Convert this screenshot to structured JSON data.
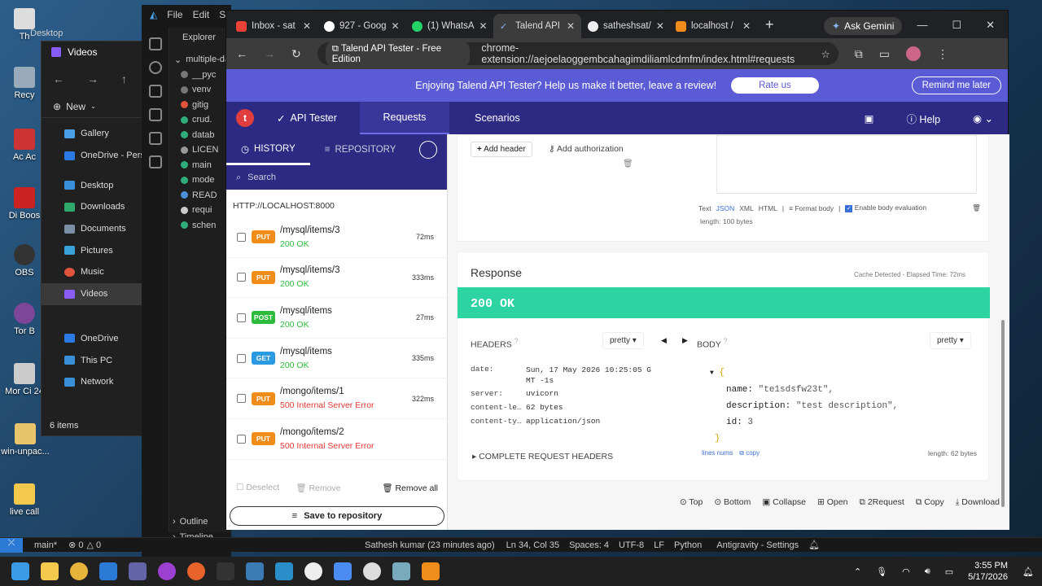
{
  "desktop": {
    "icons": [
      {
        "label": "Th"
      },
      {
        "label": "Recy"
      },
      {
        "label": "Ac Ac"
      },
      {
        "label": "Di Boos"
      },
      {
        "label": "OBS"
      },
      {
        "label": "Tor B"
      },
      {
        "label": "Mor Ci 24"
      },
      {
        "label": "win-unpac..."
      },
      {
        "label": "live call"
      }
    ]
  },
  "explorer": {
    "title": "Videos",
    "behind_title": "Desktop",
    "new_label": "New",
    "items": [
      {
        "label": "Gallery"
      },
      {
        "label": "OneDrive - Person"
      },
      {
        "label": "Desktop"
      },
      {
        "label": "Downloads"
      },
      {
        "label": "Documents"
      },
      {
        "label": "Pictures"
      },
      {
        "label": "Music"
      },
      {
        "label": "Videos"
      },
      {
        "label": "OneDrive"
      },
      {
        "label": "This PC"
      },
      {
        "label": "Network"
      }
    ],
    "status": "6 items"
  },
  "vscode": {
    "menu": [
      "File",
      "Edit",
      "S"
    ],
    "explorer_label": "Explorer",
    "folder": "multiple-da",
    "files": [
      "__pyc",
      "venv",
      "gitig",
      "crud.",
      "datab",
      "LICEN",
      "main",
      "mode",
      "READ",
      "requi",
      "schen"
    ],
    "outline": "Outline",
    "timeline": "Timeline",
    "status": {
      "branch": "main*",
      "problems": "0",
      "warnings": "0",
      "author": "Sathesh kumar (23 minutes ago)",
      "pos": "Ln 34, Col 35",
      "spaces": "Spaces: 4",
      "enc": "UTF-8",
      "eol": "LF",
      "lang": "Python",
      "settings": "Antigravity - Settings"
    }
  },
  "chrome": {
    "tabs": [
      {
        "title": "Inbox - sat"
      },
      {
        "title": "927 - Goog"
      },
      {
        "title": "(1) WhatsA"
      },
      {
        "title": "Talend API"
      },
      {
        "title": "satheshsat/"
      },
      {
        "title": "localhost /"
      }
    ],
    "gemini": "Ask Gemini",
    "site_chip": "Talend API Tester - Free Edition",
    "url": "chrome-extension://aejoelaoggembcahagimdiliamlcdmfm/index.html#requests"
  },
  "banner": {
    "text": "Enjoying Talend API Tester? Help us make it better, leave a review!",
    "rate": "Rate us",
    "remind": "Remind me later"
  },
  "appnav": {
    "logo": "t",
    "product": "API Tester",
    "tabs": [
      "Requests",
      "Scenarios"
    ],
    "help": "Help"
  },
  "history": {
    "tabs": [
      "HISTORY",
      "REPOSITORY"
    ],
    "search_placeholder": "Search",
    "host": "HTTP://LOCALHOST:8000",
    "rows": [
      {
        "method": "PUT",
        "color": "#f08c1a",
        "path": "/mysql/items/3",
        "status": "200 OK",
        "ok": true,
        "ms": "72ms"
      },
      {
        "method": "PUT",
        "color": "#f08c1a",
        "path": "/mysql/items/3",
        "status": "200 OK",
        "ok": true,
        "ms": "333ms"
      },
      {
        "method": "POST",
        "color": "#2dbb3c",
        "path": "/mysql/items",
        "status": "200 OK",
        "ok": true,
        "ms": "27ms"
      },
      {
        "method": "GET",
        "color": "#2b9ae0",
        "path": "/mysql/items",
        "status": "200 OK",
        "ok": true,
        "ms": "335ms"
      },
      {
        "method": "PUT",
        "color": "#f08c1a",
        "path": "/mongo/items/1",
        "status": "500 Internal Server Error",
        "ok": false,
        "ms": "322ms"
      },
      {
        "method": "PUT",
        "color": "#f08c1a",
        "path": "/mongo/items/2",
        "status": "500 Internal Server Error",
        "ok": false,
        "ms": ""
      }
    ],
    "deselect": "Deselect",
    "remove": "Remove",
    "remove_all": "Remove all",
    "save": "Save to repository"
  },
  "request": {
    "add_header": "Add header",
    "add_auth": "Add authorization",
    "body_formats": [
      "Text",
      "JSON",
      "XML",
      "HTML"
    ],
    "format_body": "Format body",
    "enable_eval": "Enable body evaluation",
    "length": "length: 100 bytes"
  },
  "response": {
    "title": "Response",
    "meta": "Cache Detected - Elapsed Time: 72ms",
    "status": "200 OK",
    "headers_label": "HEADERS",
    "body_label": "BODY",
    "pretty": "pretty",
    "headers": [
      {
        "k": "date:",
        "v": "Sun, 17 May 2026 10:25:05 G",
        "v2": "MT -1s"
      },
      {
        "k": "server:",
        "v": "uvicorn"
      },
      {
        "k": "content-le…",
        "v": "62 bytes"
      },
      {
        "k": "content-ty…",
        "v": "application/json"
      }
    ],
    "complete_headers": "COMPLETE REQUEST HEADERS",
    "json": [
      {
        "k": "name:",
        "v": "\"te1sdsfw23t\","
      },
      {
        "k": "description:",
        "v": "\"test description\","
      },
      {
        "k": "id:",
        "v": "3"
      }
    ],
    "lines_nums": "lines nums",
    "copy": "copy",
    "length": "length: 62 bytes"
  },
  "toolbar": [
    "Top",
    "Bottom",
    "Collapse",
    "Open",
    "2Request",
    "Copy",
    "Download"
  ],
  "taskbar": {
    "time": "3:55 PM",
    "date": "5/17/2026"
  }
}
